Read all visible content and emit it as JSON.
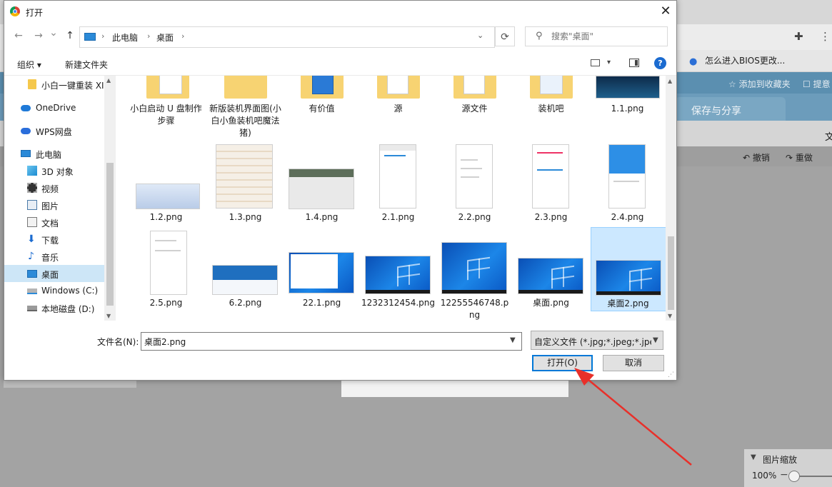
{
  "dialog": {
    "title": "打开",
    "close": "✕",
    "nav": {
      "back": "←",
      "forward": "→",
      "recent": "⌄",
      "up": "↑",
      "path": [
        "此电脑",
        "桌面"
      ],
      "sep": "›",
      "dropdown": "⌄",
      "refresh": "⟳",
      "search_placeholder": "搜索\"桌面\""
    },
    "cmd": {
      "organize": "组织 ▾",
      "new_folder": "新建文件夹",
      "view_dropdown": "▾",
      "help": "?"
    },
    "sidebar": [
      {
        "label": "小白一键重装 XI",
        "icon": "folder-icon"
      },
      {
        "label": "OneDrive",
        "icon": "cloud-icon"
      },
      {
        "label": "WPS网盘",
        "icon": "wps-cloud-icon"
      },
      {
        "label": "此电脑",
        "icon": "computer-icon"
      },
      {
        "label": "3D 对象",
        "icon": "3d-objects-icon"
      },
      {
        "label": "视频",
        "icon": "video-icon"
      },
      {
        "label": "图片",
        "icon": "pictures-icon"
      },
      {
        "label": "文档",
        "icon": "documents-icon"
      },
      {
        "label": "下载",
        "icon": "download-icon"
      },
      {
        "label": "音乐",
        "icon": "music-icon"
      },
      {
        "label": "桌面",
        "icon": "desktop-icon"
      },
      {
        "label": "Windows (C:)",
        "icon": "drive-c-icon"
      },
      {
        "label": "本地磁盘 (D:)",
        "icon": "drive-d-icon"
      }
    ],
    "files_row1": [
      "小白启动 U 盘制作步骤",
      "新版装机界面图(小白小鱼装机吧魔法猪)",
      "有价值",
      "源",
      "源文件",
      "装机吧",
      "1.1.png"
    ],
    "files_row2": [
      "1.2.png",
      "1.3.png",
      "1.4.png",
      "2.1.png",
      "2.2.png",
      "2.3.png",
      "2.4.png"
    ],
    "files_row3": [
      "2.5.png",
      "6.2.png",
      "22.1.png",
      "1232312454.png",
      "12255546748.png",
      "桌面.png",
      "桌面2.png"
    ],
    "filename_label": "文件名(N):",
    "filename_value": "桌面2.png",
    "filetype": "自定义文件 (*.jpg;*.jpeg;*.jpe;",
    "open_button": "打开(O)",
    "cancel_button": "取消"
  },
  "background": {
    "bookmark": "怎么进入BIOS更改...",
    "toolbar_items": [
      "添加到收藏夹",
      "提意"
    ],
    "tab": "保存与分享",
    "wen": "文",
    "undo": "撤销",
    "redo": "重做",
    "zoom_title": "图片缩放",
    "zoom_value": "100%",
    "zoom_minus": "−"
  },
  "colors": {
    "accent": "#0078d7",
    "selection": "#cce8ff",
    "arrow": "#e8302a"
  }
}
